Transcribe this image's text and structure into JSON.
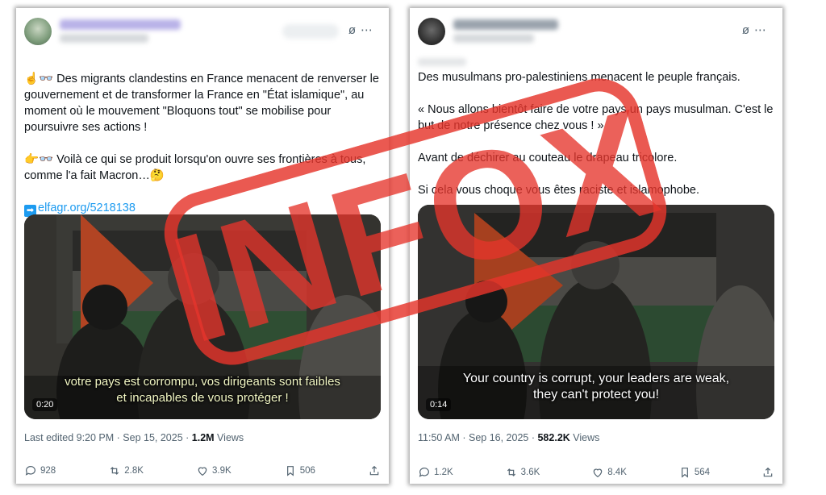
{
  "colors": {
    "accent": "#1d9bf0",
    "stamp": "#e5352b",
    "muted": "#536471"
  },
  "stamp": {
    "text": "INFOX"
  },
  "tweet1": {
    "handle_blurred": "Eric Archambault",
    "paragraphs": [
      "☝️👓 Des migrants clandestins en France menacent de renverser le gouvernement et de transformer la France en \"État islamique\", au moment où le mouvement \"Bloquons tout\" se mobilise pour poursuivre ses actions !",
      "👉👓 Voilà ce qui se produit lorsqu'on ouvre ses frontières à tous, comme l'a fait Macron…🤔"
    ],
    "link_arrow": "➡",
    "link": "elfagr.org/5218138",
    "video": {
      "subtitle_line1": "votre pays est corrompu, vos dirigeants sont faibles",
      "subtitle_line2": "et incapables de vous protéger !",
      "duration": "0:20"
    },
    "meta_prefix": "Last edited 9:20 PM · Sep 15, 2025 · ",
    "views_count": "1.2M",
    "views_label": " Views",
    "replies": "928",
    "reposts": "2.8K",
    "likes": "3.9K",
    "bookmarks": "506"
  },
  "tweet2": {
    "handle_blurred": "Sarah MESSOUD",
    "paragraphs": [
      "Des musulmans pro-palestiniens menacent le peuple français.",
      "« Nous allons bientôt faire de votre pays un pays musulman. C'est le but de notre présence chez vous ! »",
      "Avant de déchirer au couteau le drapeau tricolore.",
      "Si cela vous choque vous êtes raciste et islamophobe."
    ],
    "video": {
      "subtitle_line1": "Your country is corrupt, your leaders are weak,",
      "subtitle_line2": "they can't protect you!",
      "duration": "0:14"
    },
    "meta_prefix": "11:50 AM · Sep 16, 2025 · ",
    "views_count": "582.2K",
    "views_label": " Views",
    "replies": "1.2K",
    "reposts": "3.6K",
    "likes": "8.4K",
    "bookmarks": "564"
  },
  "icons": {
    "grok": "grok-icon",
    "more": "more-icon",
    "reply": "reply-icon",
    "repost": "repost-icon",
    "like": "like-icon",
    "bookmark": "bookmark-icon",
    "share": "share-icon"
  }
}
